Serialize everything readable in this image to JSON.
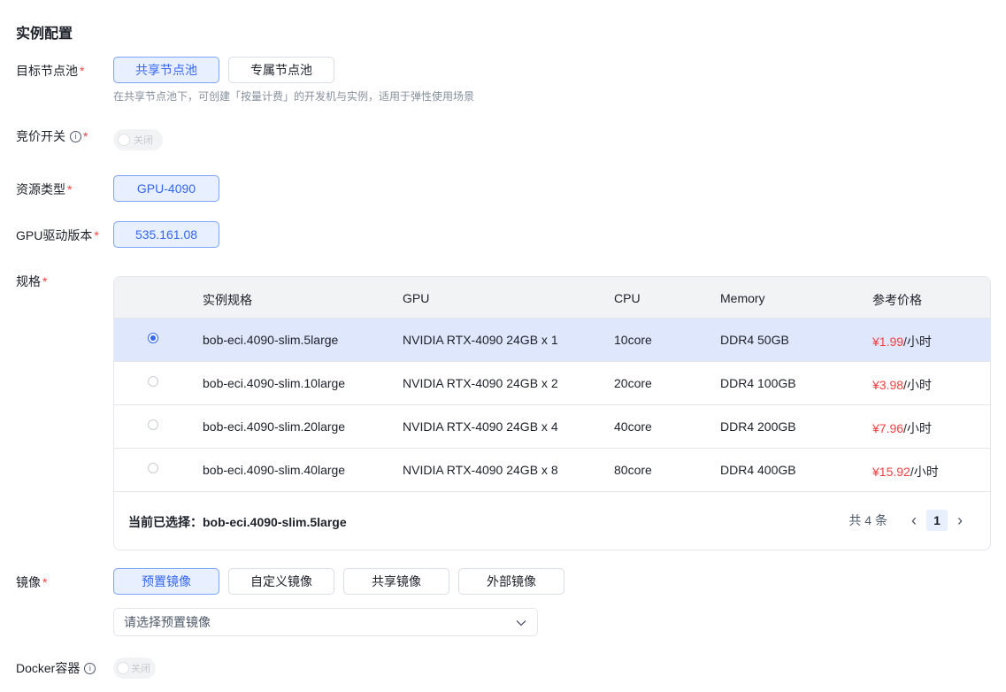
{
  "section_title": "实例配置",
  "node_pool": {
    "label": "目标节点池",
    "options": [
      "共享节点池",
      "专属节点池"
    ],
    "hint": "在共享节点池下，可创建「按量计费」的开发机与实例，适用于弹性使用场景"
  },
  "bidding": {
    "label": "竞价开关",
    "info_icon_text": "i",
    "toggle_text": "关闭"
  },
  "resource_type": {
    "label": "资源类型",
    "value": "GPU-4090"
  },
  "gpu_driver": {
    "label": "GPU驱动版本",
    "value": "535.161.08"
  },
  "spec": {
    "label": "规格",
    "columns": [
      "实例规格",
      "GPU",
      "CPU",
      "Memory",
      "参考价格"
    ],
    "rows": [
      {
        "name": "bob-eci.4090-slim.5large",
        "gpu": "NVIDIA RTX-4090 24GB x 1",
        "cpu": "10core",
        "memory": "DDR4 50GB",
        "price": "¥1.99",
        "unit": "/小时"
      },
      {
        "name": "bob-eci.4090-slim.10large",
        "gpu": "NVIDIA RTX-4090 24GB x 2",
        "cpu": "20core",
        "memory": "DDR4 100GB",
        "price": "¥3.98",
        "unit": "/小时"
      },
      {
        "name": "bob-eci.4090-slim.20large",
        "gpu": "NVIDIA RTX-4090 24GB x 4",
        "cpu": "40core",
        "memory": "DDR4 200GB",
        "price": "¥7.96",
        "unit": "/小时"
      },
      {
        "name": "bob-eci.4090-slim.40large",
        "gpu": "NVIDIA RTX-4090 24GB x 8",
        "cpu": "80core",
        "memory": "DDR4 400GB",
        "price": "¥15.92",
        "unit": "/小时"
      }
    ],
    "selected_index": 0,
    "current_selection": "当前已选择：bob-eci.4090-slim.5large",
    "total": "共 4 条",
    "page": "1",
    "prev_icon": "‹",
    "next_icon": "›"
  },
  "image": {
    "label": "镜像",
    "tabs": [
      "预置镜像",
      "自定义镜像",
      "共享镜像",
      "外部镜像"
    ],
    "select_placeholder": "请选择预置镜像",
    "chevron": "⌄"
  },
  "docker": {
    "label": "Docker容器",
    "info_icon_text": "i",
    "toggle_text": "关闭"
  },
  "colors": {
    "accent": "#3567f5",
    "accent_bg": "#e8efff",
    "required": "#f53f3f",
    "price": "#f53f3f"
  }
}
